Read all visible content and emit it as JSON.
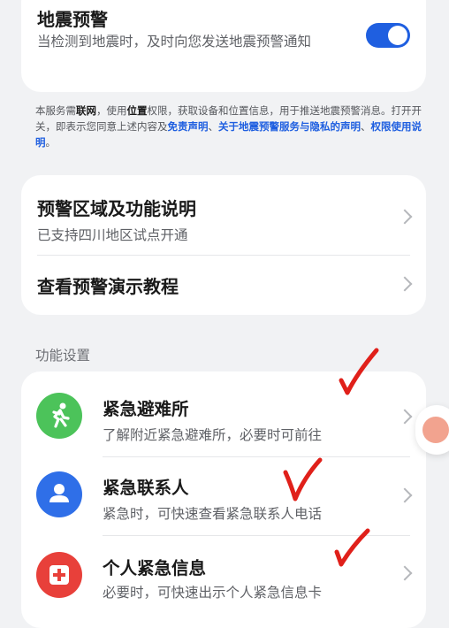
{
  "earthquake_alert": {
    "title": "地震预警",
    "description": "当检测到地震时，及时向您发送地震预警通知",
    "toggle_on": true
  },
  "notice": {
    "part1": "本服务需",
    "network": "联网",
    "part2": "，使用",
    "location": "位置",
    "part3": "权限，获取设备和位置信息，用于推送地震预警消息。打开开关，即表示您同意上述内容及",
    "link_disclaimer": "免责声明",
    "sep1": "、",
    "link_privacy": "关于地震预警服务与隐私的声明",
    "sep2": "、",
    "link_permissions": "权限使用说明",
    "end": "。"
  },
  "info_card": {
    "region": {
      "title": "预警区域及功能说明",
      "subtitle": "已支持四川地区试点开通"
    },
    "tutorial": {
      "title": "查看预警演示教程"
    }
  },
  "section": {
    "label": "功能设置"
  },
  "features": [
    {
      "title": "紧急避难所",
      "subtitle": "了解附近紧急避难所，必要时可前往",
      "icon": "running-person-icon",
      "color": "#4cc35a"
    },
    {
      "title": "紧急联系人",
      "subtitle": "紧急时，可快速查看紧急联系人电话",
      "icon": "person-icon",
      "color": "#2f6fe8"
    },
    {
      "title": "个人紧急信息",
      "subtitle": "必要时，可快速出示个人紧急信息卡",
      "icon": "medical-cross-icon",
      "color": "#e8403a"
    }
  ],
  "colors": {
    "accent": "#1f5fe0",
    "annotation_red": "#e0201a"
  }
}
